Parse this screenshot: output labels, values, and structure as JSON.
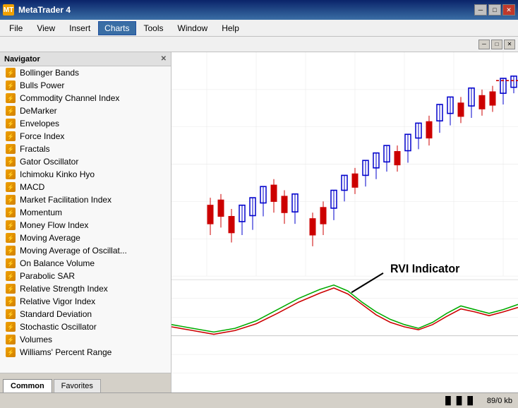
{
  "titleBar": {
    "title": "MetaTrader 4",
    "minLabel": "─",
    "maxLabel": "□",
    "closeLabel": "✕"
  },
  "menuBar": {
    "items": [
      {
        "id": "file",
        "label": "File"
      },
      {
        "id": "view",
        "label": "View"
      },
      {
        "id": "insert",
        "label": "Insert"
      },
      {
        "id": "charts",
        "label": "Charts"
      },
      {
        "id": "tools",
        "label": "Tools"
      },
      {
        "id": "window",
        "label": "Window"
      },
      {
        "id": "help",
        "label": "Help"
      }
    ],
    "activeItem": "charts"
  },
  "innerControls": {
    "minLabel": "─",
    "maxLabel": "□",
    "closeLabel": "✕"
  },
  "navigator": {
    "title": "Navigator",
    "closeLabel": "✕",
    "items": [
      {
        "label": "Bollinger Bands"
      },
      {
        "label": "Bulls Power"
      },
      {
        "label": "Commodity Channel Index"
      },
      {
        "label": "DeMarker"
      },
      {
        "label": "Envelopes"
      },
      {
        "label": "Force Index"
      },
      {
        "label": "Fractals"
      },
      {
        "label": "Gator Oscillator"
      },
      {
        "label": "Ichimoku Kinko Hyo"
      },
      {
        "label": "MACD"
      },
      {
        "label": "Market Facilitation Index"
      },
      {
        "label": "Momentum"
      },
      {
        "label": "Money Flow Index"
      },
      {
        "label": "Moving Average"
      },
      {
        "label": "Moving Average of Oscillat..."
      },
      {
        "label": "On Balance Volume"
      },
      {
        "label": "Parabolic SAR"
      },
      {
        "label": "Relative Strength Index"
      },
      {
        "label": "Relative Vigor Index"
      },
      {
        "label": "Standard Deviation"
      },
      {
        "label": "Stochastic Oscillator"
      },
      {
        "label": "Volumes"
      },
      {
        "label": "Williams' Percent Range"
      }
    ],
    "tabs": [
      {
        "id": "common",
        "label": "Common",
        "active": true
      },
      {
        "id": "favorites",
        "label": "Favorites",
        "active": false
      }
    ]
  },
  "chart": {
    "rviLabel": "RVI Indicator"
  },
  "statusBar": {
    "icons": "▐▌▐▌▐▌",
    "size": "89/0 kb"
  }
}
